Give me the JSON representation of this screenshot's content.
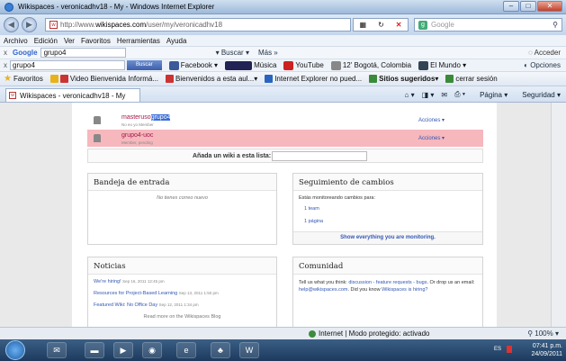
{
  "window": {
    "title": "Wikispaces - veronicadhv18 - My - Windows Internet Explorer"
  },
  "address": {
    "url_prefix": "http://www.",
    "url_domain": "wikispaces.com",
    "url_path": "/user/my/veronicadhv18",
    "search_placeholder": "Google"
  },
  "menu": [
    "Archivo",
    "Edición",
    "Ver",
    "Favoritos",
    "Herramientas",
    "Ayuda"
  ],
  "google_toolbar": {
    "query": "grupo4",
    "buscar": "Buscar",
    "mas": "Más »",
    "acceder": "Acceder"
  },
  "toolbar2": {
    "query": "grupo4",
    "buscar": "Buscar",
    "facebook": "Facebook",
    "musica": "Música",
    "youtube": "YouTube",
    "weather": "12' Bogotá, Colombia",
    "elmundo": "El Mundo",
    "opciones": "Opciones"
  },
  "favorites": {
    "label": "Favoritos",
    "items": [
      "Video Bienvenida Informá...",
      "Bienvenidos a esta aul...",
      "Internet Explorer no pued...",
      "Sitios sugeridos",
      "cerrar sesión"
    ]
  },
  "tab": {
    "label": "Wikispaces - veronicadhv18 - My"
  },
  "commandbar": {
    "pagina": "Página",
    "seguridad": "Seguridad"
  },
  "wikis": [
    {
      "name_prefix": "masteruso",
      "name_highlight": "grupo4",
      "sub": "No eo yo Member",
      "action": "Acciones"
    },
    {
      "name_prefix": "grupo4-uoc",
      "name_highlight": "",
      "sub": "Member, pending",
      "action": "Acciones"
    }
  ],
  "add_wiki_label": "Añada un wiki a esta lista:",
  "inbox": {
    "title": "Bandeja de entrada",
    "empty": "No tienes correo nuevo"
  },
  "tracking": {
    "title": "Seguimiento de cambios",
    "intro": "Estás monitoreando cambios para:",
    "items": [
      "1 team",
      "1 página"
    ],
    "footer_link": "Show everything you are monitoring."
  },
  "news": {
    "title": "Noticias",
    "items": [
      {
        "text": "We're hiring!",
        "date": "Sep 16, 2011 12:45 pm"
      },
      {
        "text": "Resources for Project-Based Learning",
        "date": "Sep 13, 2011 1:50 pm"
      },
      {
        "text": "Featured Wiki: No Office Day",
        "date": "Sep 12, 2011 1:34 pm"
      }
    ],
    "more": "Read more on the Wikispaces Blog"
  },
  "community": {
    "title": "Comunidad",
    "p1": "Tell us what you think: ",
    "l1": "discussion - feature requests - bugs",
    "p2": ". Or drop us an email: ",
    "l2": "help@wikispaces.com",
    "p3": ". Did you know ",
    "l3": "Wikispaces is hiring?"
  },
  "status": {
    "text": "Internet | Modo protegido: activado",
    "zoom": "100%"
  },
  "tray": {
    "lang": "ES",
    "time": "07:41 p.m.",
    "date": "24/09/2011"
  }
}
